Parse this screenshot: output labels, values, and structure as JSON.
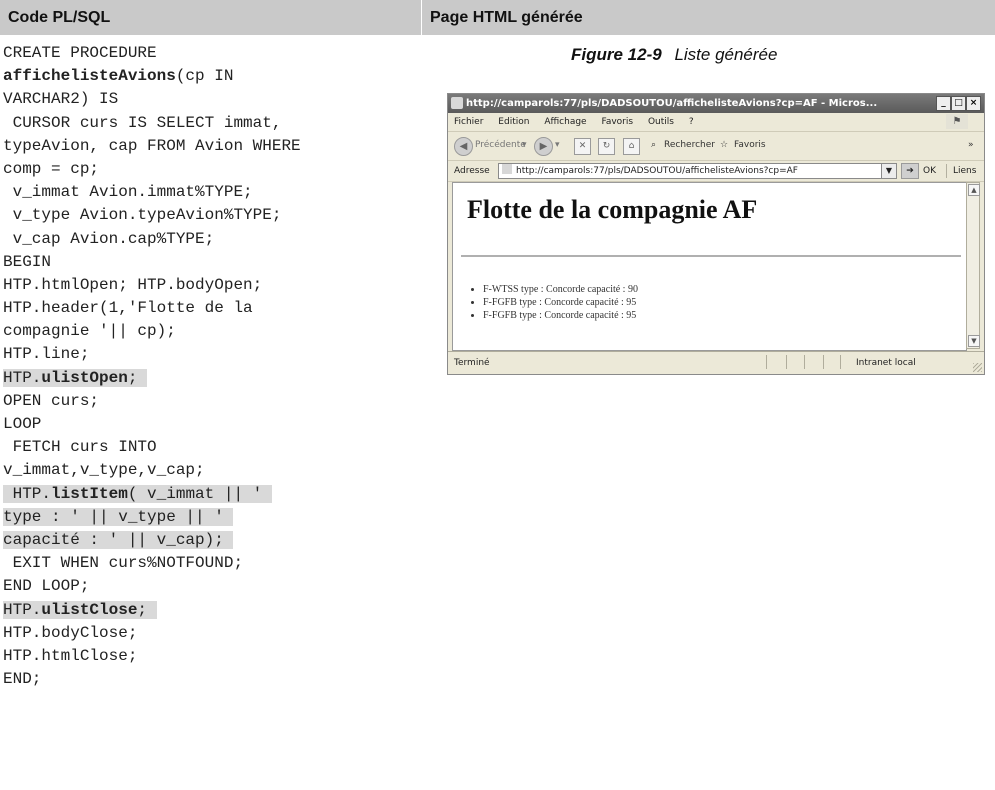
{
  "headers": {
    "left": "Code PL/SQL",
    "right": "Page HTML générée"
  },
  "code_lines": [
    [
      "CREATE PROCEDURE"
    ],
    [
      "<b>affichelisteAvions</b>(cp IN"
    ],
    [
      "VARCHAR2) IS"
    ],
    [
      " CURSOR curs IS SELECT immat,"
    ],
    [
      "typeAvion, cap FROM Avion WHERE"
    ],
    [
      "comp = cp;"
    ],
    [
      " v_immat Avion.immat%TYPE;"
    ],
    [
      " v_type Avion.typeAvion%TYPE;"
    ],
    [
      " v_cap Avion.cap%TYPE;"
    ],
    [
      "BEGIN"
    ],
    [
      "HTP.htmlOpen; HTP.bodyOpen;"
    ],
    [
      "HTP.header(1,'Flotte de la"
    ],
    [
      "compagnie '|| cp);"
    ],
    [
      "HTP.line;"
    ],
    [
      "<span class=\"hl\">HTP.<b>ulistOpen</b>; </span>"
    ],
    [
      "OPEN curs;"
    ],
    [
      "LOOP"
    ],
    [
      " FETCH curs INTO"
    ],
    [
      "v_immat,v_type,v_cap;"
    ],
    [
      "<span class=\"hl\"> HTP.<b>listItem</b>( v_immat || ' </span>"
    ],
    [
      "<span class=\"hl\">type : ' || v_type || ' </span>"
    ],
    [
      "<span class=\"hl\">capacité : ' || v_cap); </span>"
    ],
    [
      " EXIT WHEN curs%NOTFOUND;"
    ],
    [
      "END LOOP;"
    ],
    [
      "<span class=\"hl\">HTP.<b>ulistClose</b>; </span>"
    ],
    [
      "HTP.bodyClose;"
    ],
    [
      "HTP.htmlClose;"
    ],
    [
      "END;"
    ]
  ],
  "figure": {
    "number": "Figure 12-9",
    "title": "Liste générée"
  },
  "browser": {
    "title": "http://camparols:77/pls/DADSOUTOU/affichelisteAvions?cp=AF - Micros...",
    "menu": [
      "Fichier",
      "Edition",
      "Affichage",
      "Favoris",
      "Outils",
      "?"
    ],
    "toolbar": {
      "back": "Précédente",
      "search": "Rechercher",
      "favorites": "Favoris"
    },
    "address_label": "Adresse",
    "address_value": "http://camparols:77/pls/DADSOUTOU/affichelisteAvions?cp=AF",
    "go_label": "OK",
    "links_label": "Liens",
    "page_heading": "Flotte de la compagnie AF",
    "list_items": [
      "F-WTSS type : Concorde capacité : 90",
      "F-FGFB type : Concorde capacité : 95",
      "F-FGFB type : Concorde capacité : 95"
    ],
    "status": "Terminé",
    "zone": "Intranet local"
  }
}
